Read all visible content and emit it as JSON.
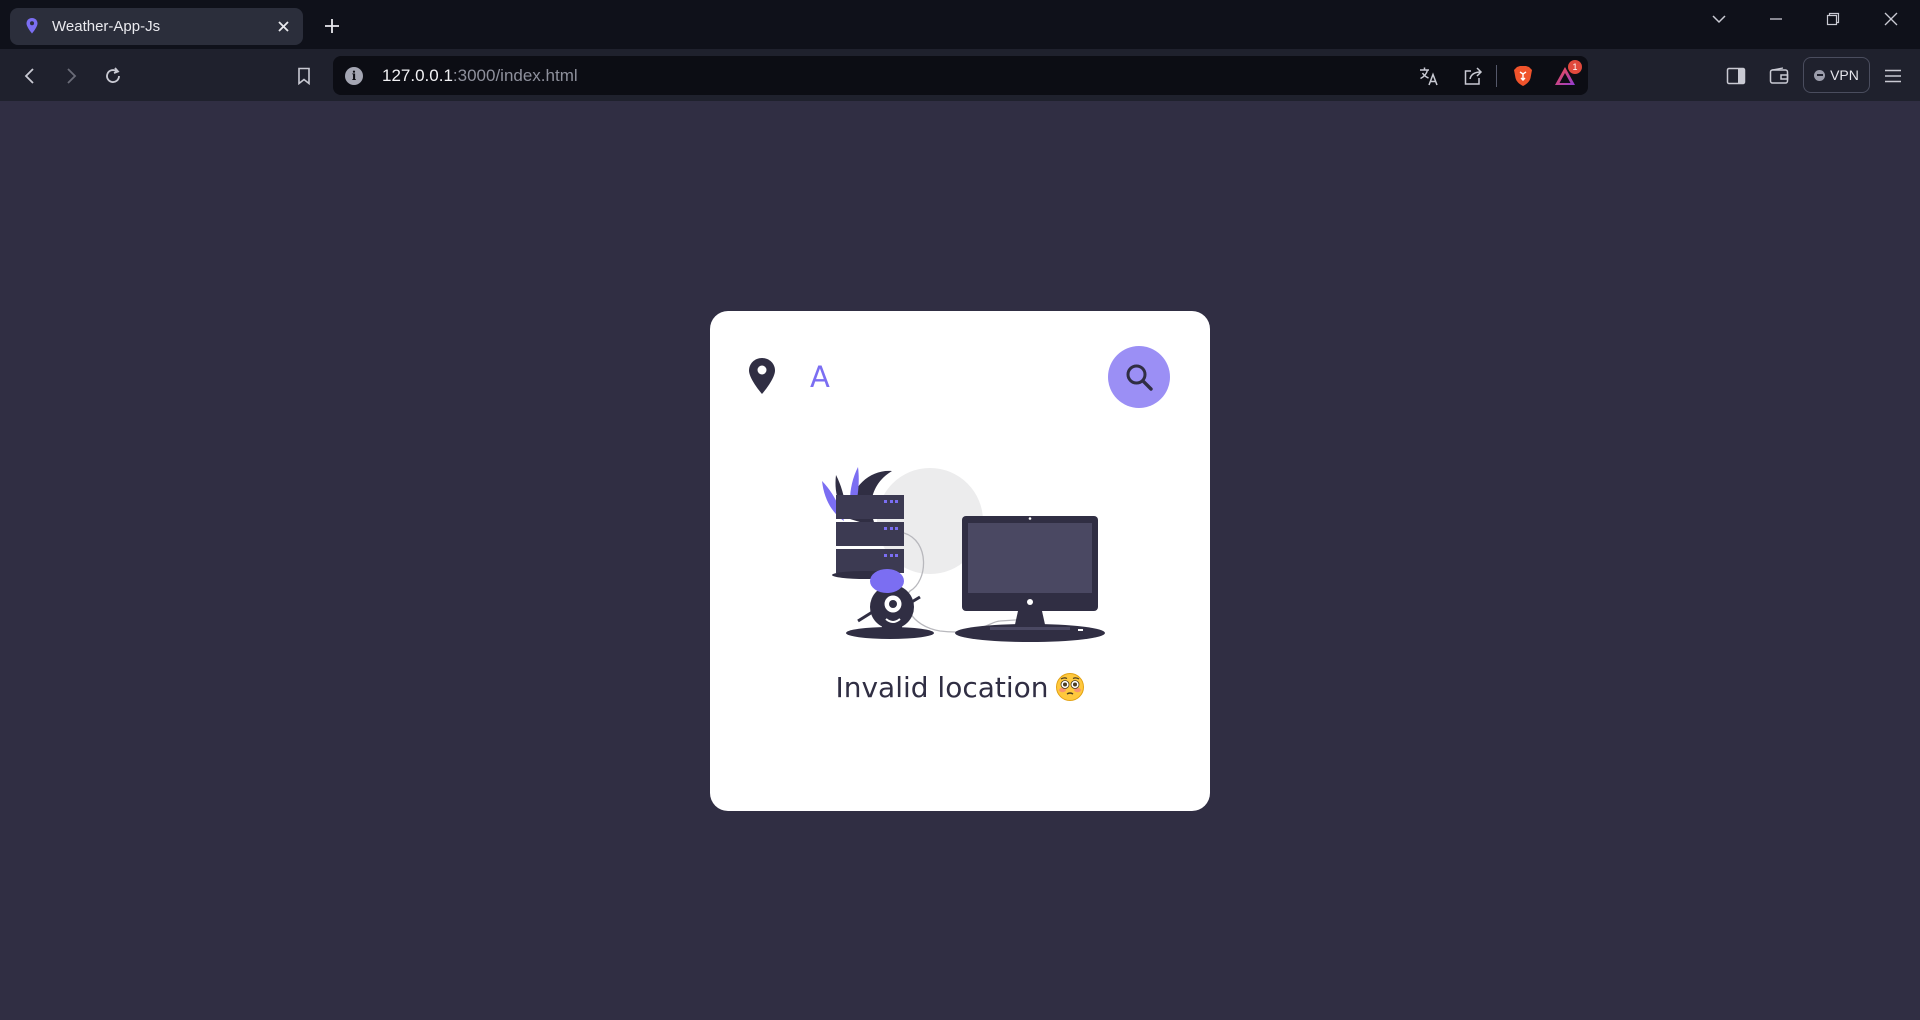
{
  "browser": {
    "tab_title": "Weather-App-Js",
    "url_host": "127.0.0.1",
    "url_rest": ":3000/index.html",
    "notification_count": "1",
    "vpn_label": "VPN"
  },
  "app": {
    "search_value": "A",
    "message": "Invalid location",
    "accent_color": "#9b8ff5",
    "background_color": "#302e43"
  }
}
